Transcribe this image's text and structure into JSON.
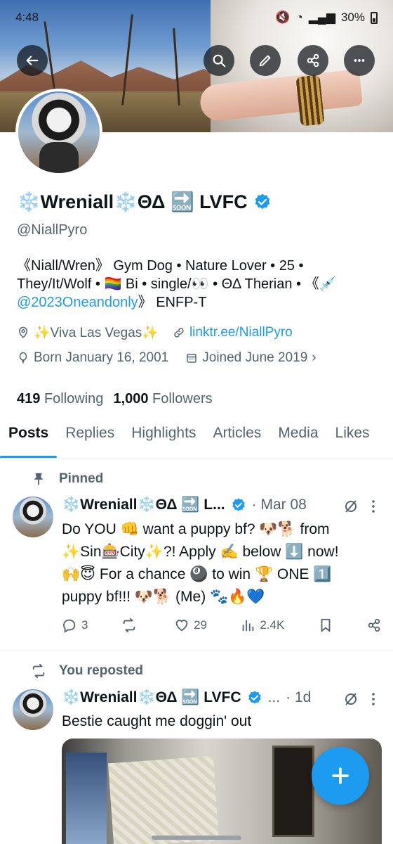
{
  "status_bar": {
    "time": "4:48",
    "battery": "30%"
  },
  "header": {
    "back_icon": "arrow-left-icon",
    "search_icon": "search-icon",
    "edit_icon": "pencil-icon",
    "share_icon": "share-icon",
    "more_icon": "more-icon"
  },
  "profile": {
    "name": "❄️Wreniall❄️ΘΔ 🔜 LVFC",
    "handle": "@NiallPyro",
    "bio_lines": [
      "《Niall/Wren》 Gym Dog • Nature Lover • 25 •",
      "They/It/Wolf • 🏳️‍🌈 Bi • single/👀 • ΘΔ Therian • 《💉",
      "》 ENFP-T"
    ],
    "bio_link": "@2023Oneandonly",
    "location": "✨Viva Las Vegas✨",
    "website": "linktr.ee/NiallPyro",
    "born": "Born January 16, 2001",
    "joined": "Joined June 2019",
    "following_count": "419",
    "following_label": "Following",
    "followers_count": "1,000",
    "followers_label": "Followers"
  },
  "tabs": [
    "Posts",
    "Replies",
    "Highlights",
    "Articles",
    "Media",
    "Likes"
  ],
  "active_tab": "Posts",
  "posts": [
    {
      "context": "Pinned",
      "author": "❄️Wreniall❄️ΘΔ 🔜 L...",
      "time": "· Mar 08",
      "lines": [
        "Do YOU 👊 want a puppy bf? 🐶🐕 from",
        "✨Sin🎰City✨?! Apply ✍️ below ⬇️ now!",
        "🙌😇 For a chance 🎱 to win 🏆 ONE 1️⃣",
        "puppy bf!!! 🐶🐕 (Me) 🐾🔥💙"
      ],
      "replies": "3",
      "reposts": "",
      "likes": "29",
      "views": "2.4K"
    },
    {
      "context": "You reposted",
      "author": "❄️Wreniall❄️ΘΔ 🔜 LVFC",
      "ellipsis": "...",
      "time": "· 1d",
      "lines": [
        "Bestie caught me doggin' out"
      ]
    }
  ],
  "fab_icon": "plus-icon",
  "colors": {
    "accent": "#1d9bf0",
    "text": "#0f1419",
    "muted": "#536471"
  }
}
